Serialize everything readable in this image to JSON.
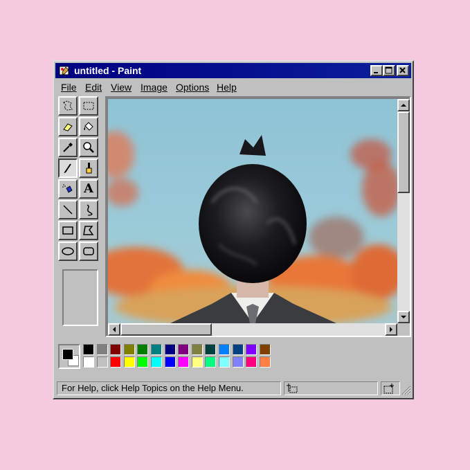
{
  "window": {
    "title": "untitled - Paint"
  },
  "menu": [
    {
      "label": "File"
    },
    {
      "label": "Edit"
    },
    {
      "label": "View"
    },
    {
      "label": "Image"
    },
    {
      "label": "Options"
    },
    {
      "label": "Help"
    }
  ],
  "tools": [
    {
      "name": "free-form-select"
    },
    {
      "name": "rectangle-select"
    },
    {
      "name": "eraser"
    },
    {
      "name": "fill-bucket"
    },
    {
      "name": "color-picker"
    },
    {
      "name": "magnifier"
    },
    {
      "name": "pencil",
      "active": true
    },
    {
      "name": "brush"
    },
    {
      "name": "airbrush"
    },
    {
      "name": "text",
      "glyph": "A"
    },
    {
      "name": "line"
    },
    {
      "name": "curve"
    },
    {
      "name": "rectangle"
    },
    {
      "name": "polygon"
    },
    {
      "name": "ellipse"
    },
    {
      "name": "rounded-rectangle"
    }
  ],
  "palette": {
    "foreground": "#000000",
    "background": "#ffffff",
    "top_row": [
      "#000000",
      "#808080",
      "#800000",
      "#808000",
      "#008000",
      "#008080",
      "#000080",
      "#800080",
      "#808040",
      "#004040",
      "#0080ff",
      "#004080",
      "#8000ff",
      "#804000"
    ],
    "bottom_row": [
      "#ffffff",
      "#c0c0c0",
      "#ff0000",
      "#ffff00",
      "#00ff00",
      "#00ffff",
      "#0000ff",
      "#ff00ff",
      "#ffff80",
      "#00ff80",
      "#80ffff",
      "#8080ff",
      "#ff0080",
      "#ff8040"
    ]
  },
  "status": {
    "help_text": "For Help, click Help Topics on the Help Menu."
  }
}
